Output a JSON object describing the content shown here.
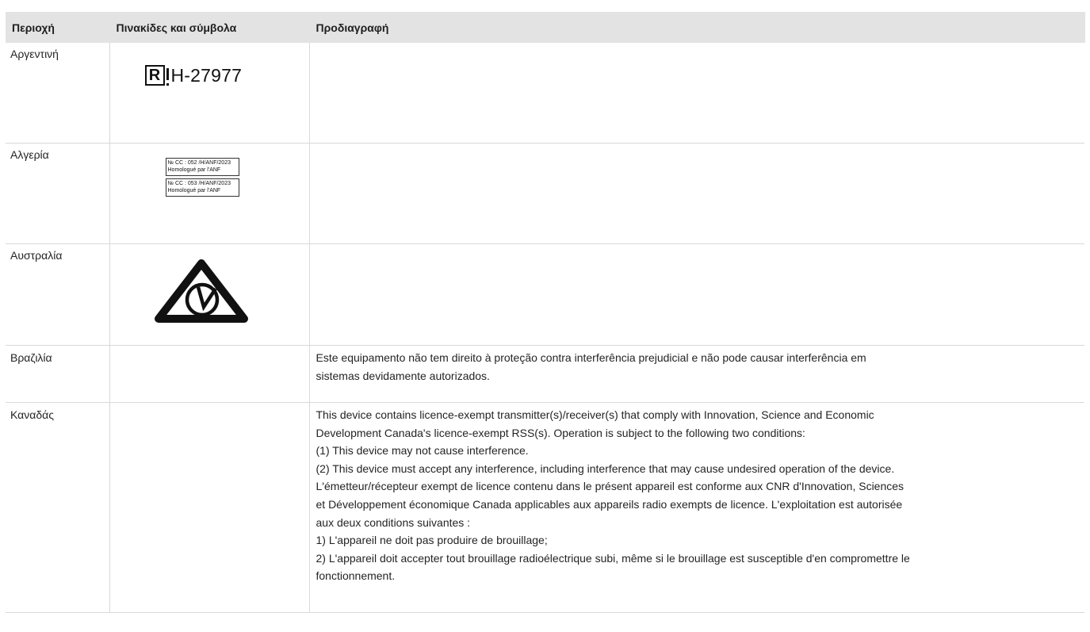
{
  "table": {
    "headers": [
      "Περιοχή",
      "Πινακίδες και σύμβολα",
      "Προδιαγραφή"
    ],
    "rows": [
      {
        "region": "Αργεντινή",
        "mark": {
          "code": "H-27977",
          "icon": "r-mark-icon"
        },
        "spec": []
      },
      {
        "region": "Αλγερία",
        "mark": {
          "labels": [
            {
              "line1": "№ CC : 052 /H/ANF/2023",
              "line2": "Homologué par l'ANF"
            },
            {
              "line1": "№ CC : 053 /H/ANF/2023",
              "line2": "Homologué par l'ANF"
            }
          ]
        },
        "spec": []
      },
      {
        "region": "Αυστραλία",
        "mark": {
          "icon": "rcm-compliance-icon"
        },
        "spec": []
      },
      {
        "region": "Βραζιλία",
        "spec": [
          "Este equipamento não tem direito à proteção contra interferência prejudicial e não pode causar interferência em",
          "sistemas devidamente autorizados."
        ]
      },
      {
        "region": "Καναδάς",
        "spec": [
          "This device contains licence-exempt transmitter(s)/receiver(s) that comply with Innovation, Science and Economic",
          "Development Canada's licence-exempt RSS(s). Operation is subject to the following two conditions:",
          "(1) This device may not cause interference.",
          "(2) This device must accept any interference, including interference that may cause undesired operation of the device.",
          "L'émetteur/récepteur exempt de licence contenu dans le présent appareil est conforme aux CNR d'Innovation, Sciences",
          "et Développement économique Canada applicables aux appareils radio exempts de licence. L'exploitation est autorisée",
          "aux deux conditions suivantes :",
          "1) L'appareil ne doit pas produire de brouillage;",
          "2) L'appareil doit accepter tout brouillage radioélectrique subi, même si le brouillage est susceptible d'en compromettre le",
          "fonctionnement."
        ]
      }
    ]
  },
  "colors": {
    "header_bg": "#e3e3e3",
    "border": "#d9d9d9",
    "text": "#242424"
  }
}
